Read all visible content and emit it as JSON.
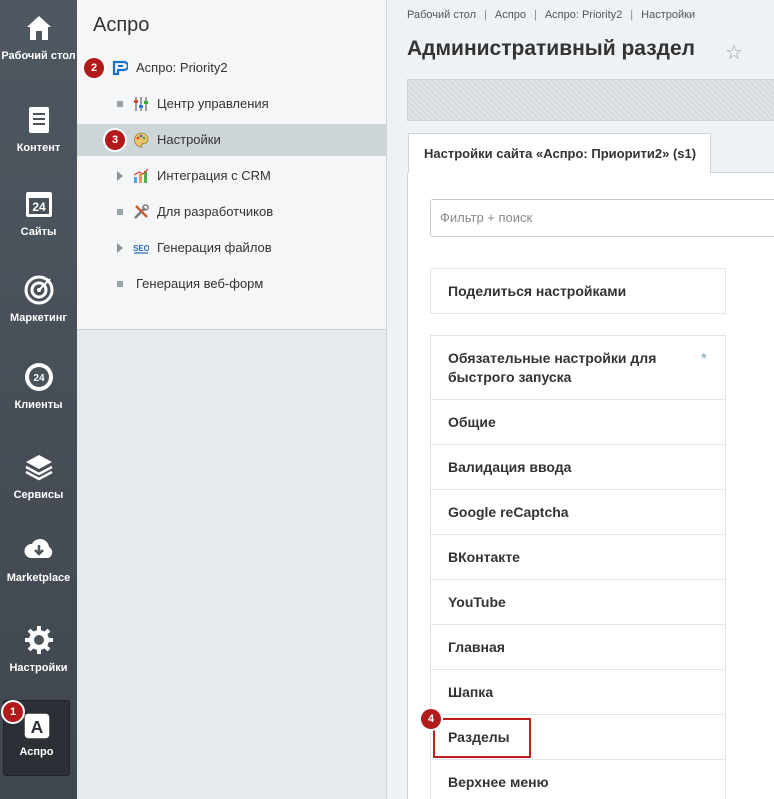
{
  "leftbar": {
    "items": [
      {
        "label": "Рабочий стол",
        "icon": "home-icon"
      },
      {
        "label": "Контент",
        "icon": "document-icon"
      },
      {
        "label": "Сайты",
        "icon": "calendar-24-icon"
      },
      {
        "label": "Маркетинг",
        "icon": "target-icon"
      },
      {
        "label": "Клиенты",
        "icon": "clients-24-icon"
      },
      {
        "label": "Сервисы",
        "icon": "layers-icon"
      },
      {
        "label": "Marketplace",
        "icon": "cloud-download-icon"
      },
      {
        "label": "Настройки",
        "icon": "gear-icon"
      },
      {
        "label": "Аспро",
        "icon": "aspro-a-icon"
      }
    ],
    "badge": "1"
  },
  "menu": {
    "title": "Аспро",
    "root": {
      "label": "Аспро: Priority2",
      "badge": "2"
    },
    "items": [
      {
        "label": "Центр управления",
        "icon": "sliders-icon"
      },
      {
        "label": "Настройки",
        "icon": "palette-icon",
        "badge": "3"
      },
      {
        "label": "Интеграция с CRM",
        "icon": "chart-icon"
      },
      {
        "label": "Для разработчиков",
        "icon": "tools-icon"
      },
      {
        "label": "Генерация файлов",
        "icon": "seo-icon"
      },
      {
        "label": "Генерация веб-форм"
      }
    ]
  },
  "breadcrumb": [
    "Рабочий стол",
    "Аспро",
    "Аспро: Priority2",
    "Настройки"
  ],
  "page_title": "Административный раздел",
  "tab_label": "Настройки сайта «Аспро: Приорити2» (s1)",
  "search_placeholder": "Фильтр + поиск",
  "share_label": "Поделиться настройками",
  "settings_list": [
    "Обязательные настройки для быстрого запуска",
    "Общие",
    "Валидация ввода",
    "Google reCaptcha",
    "ВКонтакте",
    "YouTube",
    "Главная",
    "Шапка",
    "Разделы",
    "Верхнее меню"
  ],
  "required_mark": "*",
  "highlight_badge": "4",
  "colors": {
    "badge": "#b11a1a",
    "highlight": "#c01d1d",
    "leftbar": "#4a525a"
  }
}
